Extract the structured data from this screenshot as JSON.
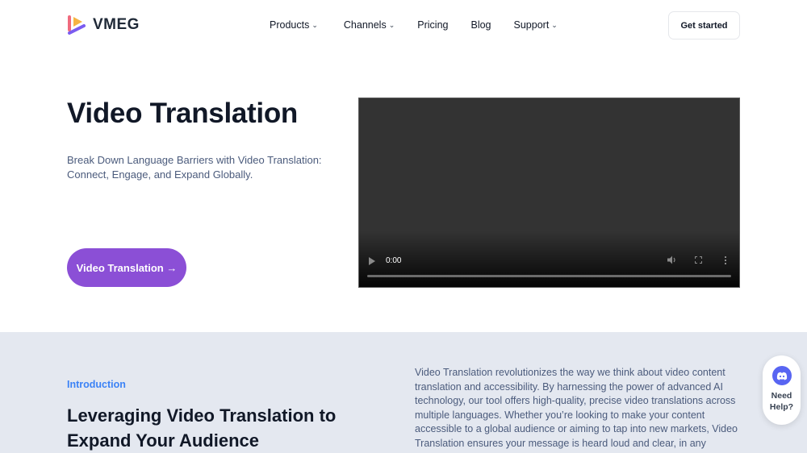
{
  "header": {
    "logo_text": "VMEG",
    "nav": [
      {
        "label": "Products",
        "has_dropdown": true
      },
      {
        "label": "Channels",
        "has_dropdown": true
      },
      {
        "label": "Pricing",
        "has_dropdown": false
      },
      {
        "label": "Blog",
        "has_dropdown": false
      },
      {
        "label": "Support",
        "has_dropdown": true
      }
    ],
    "chevron_glyph": "⌄",
    "get_started_label": "Get started"
  },
  "hero": {
    "title": "Video Translation",
    "subtitle": "Break Down Language Barriers with Video Translation: Connect, Engage, and Expand Globally.",
    "cta_label": "Video Translation →",
    "cta_color": "#8b4fd6"
  },
  "video": {
    "current_time": "0:00",
    "icons": [
      "play-icon",
      "volume-icon",
      "fullscreen-icon",
      "more-options-icon"
    ]
  },
  "intro": {
    "label": "Introduction",
    "heading": "Leveraging Video Translation to Expand Your Audience",
    "body": "Video Translation revolutionizes the way we think about video content translation and accessibility. By harnessing the power of advanced AI technology, our tool offers high-quality, precise video translations across multiple languages. Whether you’re looking to make your content accessible to a global audience or aiming to tap into new markets, Video Translation ensures your message is heard loud and clear, in any"
  },
  "help_widget": {
    "label": "Need Help?",
    "icon": "discord-icon"
  },
  "colors": {
    "accent_purple": "#8b4fd6",
    "accent_blue": "#3b82f6",
    "section_bg": "#e4e8f0",
    "discord": "#5865f2"
  }
}
